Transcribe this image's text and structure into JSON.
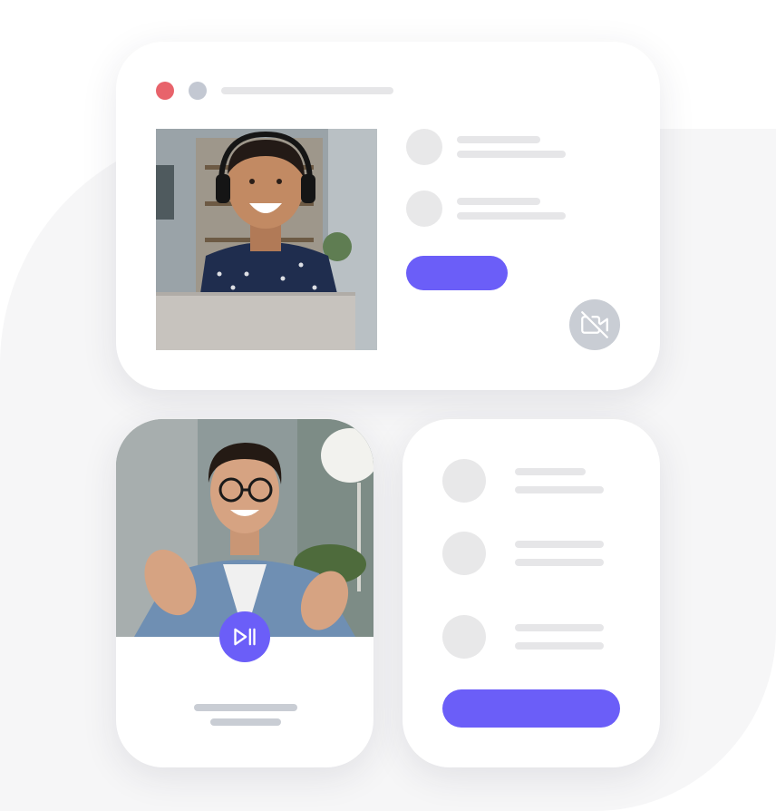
{
  "colors": {
    "accent": "#6b5ef8",
    "close_dot": "#e8636b",
    "minimize_dot": "#c3c8d2",
    "placeholder_light": "#e6e6e8",
    "placeholder_mid": "#c9cdd4",
    "icon_button_bg": "#c9cdd4",
    "background_blob": "#f6f6f7"
  },
  "window": {
    "controls": [
      "close-dot",
      "minimize-dot"
    ],
    "title_placeholder": true
  },
  "top_card": {
    "video_tile": {
      "image": "woman-with-headset-on-video-call",
      "image_description_icon": "person-photo"
    },
    "participants": [
      {
        "avatar": "avatar-placeholder"
      },
      {
        "avatar": "avatar-placeholder"
      }
    ],
    "primary_button": {
      "icon": "none"
    },
    "camera_toggle": {
      "icon": "video-off-icon",
      "state": "camera-off"
    }
  },
  "bottom_left_card": {
    "video_tile": {
      "image": "man-with-glasses-gesturing-on-video-call"
    },
    "media_control": {
      "icon": "play-pause-icon"
    }
  },
  "bottom_right_card": {
    "list_items": [
      {
        "avatar": "avatar-placeholder"
      },
      {
        "avatar": "avatar-placeholder"
      },
      {
        "avatar": "avatar-placeholder"
      }
    ],
    "primary_button": {
      "icon": "none"
    }
  }
}
